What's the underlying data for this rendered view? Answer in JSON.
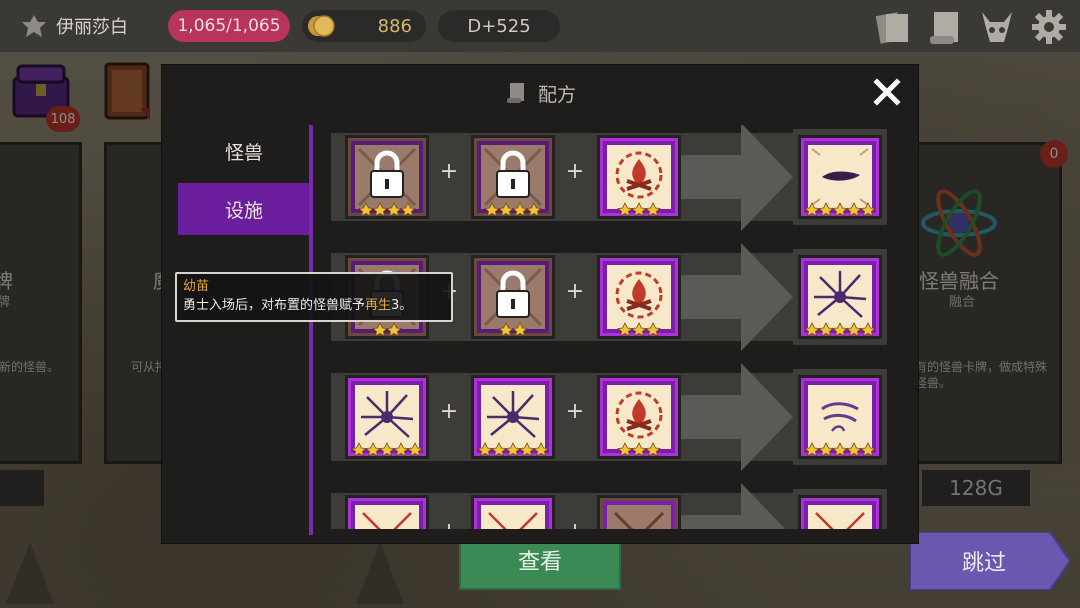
{
  "player": {
    "name": "伊丽莎白",
    "hp": "1,065/1,065",
    "gold": "886",
    "day": "D+525"
  },
  "top_icons": [
    "cards-icon",
    "scroll-icon",
    "demon-skull-icon",
    "gear-icon"
  ],
  "background": {
    "chest_count": "108",
    "right_card": {
      "title": "怪兽融合",
      "subtitle": "融合",
      "desc": "有的怪兽卡牌，做成特殊怪兽。"
    },
    "left_card": {
      "title": "牌",
      "subtitle": "牌",
      "desc": "新的怪兽。"
    },
    "mid_card": {
      "title": "魔",
      "desc": "可从持王"
    },
    "right_badge": "0",
    "price": "128G",
    "left_price": "5"
  },
  "buttons": {
    "view": "查看",
    "skip": "跳过"
  },
  "modal": {
    "title": "配方",
    "close": "X",
    "tabs": [
      {
        "label": "怪兽",
        "active": false
      },
      {
        "label": "设施",
        "active": true
      }
    ],
    "recipes": [
      {
        "inputs": [
          {
            "kind": "locked",
            "stars": 4
          },
          {
            "kind": "locked",
            "stars": 4
          },
          {
            "kind": "campfire",
            "stars": 3
          }
        ],
        "result": {
          "kind": "smudge",
          "stars": 5
        }
      },
      {
        "inputs": [
          {
            "kind": "locked",
            "stars": 2
          },
          {
            "kind": "locked",
            "stars": 2
          },
          {
            "kind": "campfire",
            "stars": 3
          }
        ],
        "result": {
          "kind": "crack",
          "stars": 5
        }
      },
      {
        "inputs": [
          {
            "kind": "crack",
            "stars": 5
          },
          {
            "kind": "crack",
            "stars": 5
          },
          {
            "kind": "campfire",
            "stars": 3
          }
        ],
        "result": {
          "kind": "wind",
          "stars": 5
        }
      },
      {
        "inputs": [
          {
            "kind": "rune",
            "stars": 0
          },
          {
            "kind": "rune",
            "stars": 0
          },
          {
            "kind": "rune-dark",
            "stars": 0
          }
        ],
        "result": {
          "kind": "rune",
          "stars": 0
        }
      }
    ],
    "plus": "+"
  },
  "tooltip": {
    "title": "幼苗",
    "desc_before": "勇士入场后，对布置的怪兽赋予",
    "desc_highlight": "再生",
    "desc_after": "3。"
  },
  "colors": {
    "accent_purple": "#6b1f9e",
    "hp_pink": "#b8345a",
    "gold": "#d8b86a",
    "view_green": "#3b8a55",
    "skip_purple": "#6a58b0",
    "highlight_orange": "#e8a63a"
  }
}
